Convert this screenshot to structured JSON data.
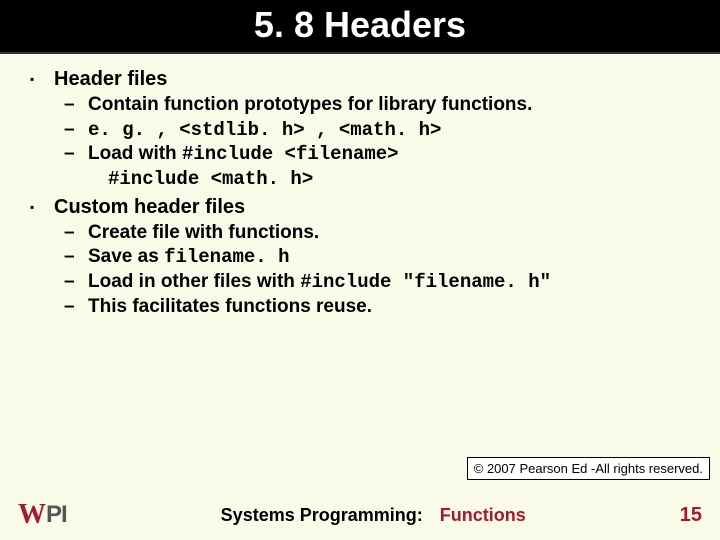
{
  "title": "5. 8 Headers",
  "bullets": [
    {
      "label": "Header files",
      "items": [
        {
          "text": "Contain function prototypes for library functions."
        },
        {
          "html": "<span class='mono'>e. g. , &lt;stdlib. h&gt; , &lt;math. h&gt;</span>"
        },
        {
          "html": "Load with <span class='mono'>#include &lt;filename&gt;</span><span class='cont mono'>#include &lt;math. h&gt;</span>"
        }
      ]
    },
    {
      "label": "Custom header files",
      "items": [
        {
          "text": "Create file with functions."
        },
        {
          "html": "Save as <span class='mono'>filename. h</span>"
        },
        {
          "html": "Load in other files with <span class='mono'>#include \"filename. h\"</span>"
        },
        {
          "text": "This facilitates functions reuse."
        }
      ]
    }
  ],
  "copyright": "© 2007 Pearson Ed -All rights reserved.",
  "footer": {
    "logo_w": "W",
    "logo_pi": "PI",
    "course": "Systems Programming:",
    "topic": "Functions",
    "page": "15"
  }
}
